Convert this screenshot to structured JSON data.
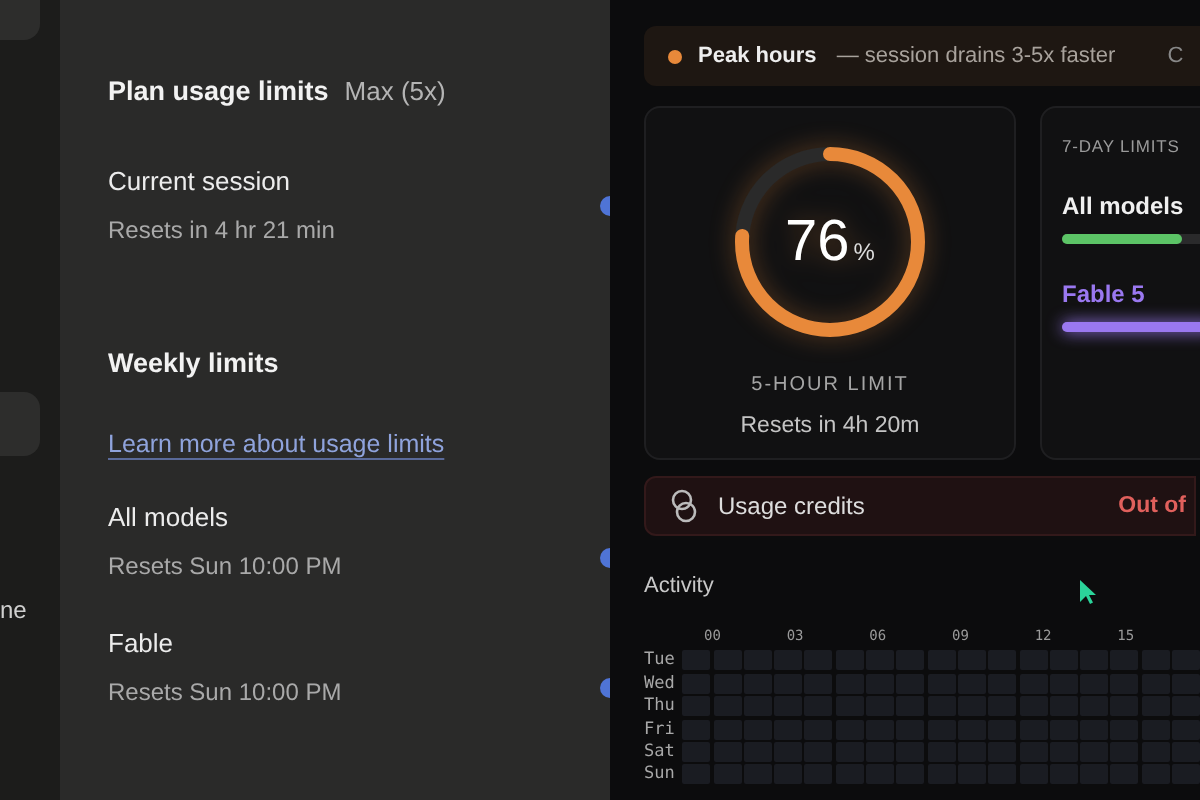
{
  "sidebar_fragment": "ne",
  "plan": {
    "title": "Plan usage limits",
    "tier": "Max (5x)"
  },
  "session": {
    "name": "Current session",
    "reset": "Resets in 4 hr 21 min"
  },
  "weekly": {
    "title": "Weekly limits",
    "link": "Learn more about usage limits",
    "items": [
      {
        "name": "All models",
        "reset": "Resets Sun 10:00 PM"
      },
      {
        "name": "Fable",
        "reset": "Resets Sun 10:00 PM"
      }
    ]
  },
  "peak": {
    "label": "Peak hours",
    "detail": "— session drains 3-5x faster",
    "trailing": "C"
  },
  "five_hour": {
    "value": "76",
    "unit": "%",
    "level": 0.76,
    "label": "5-HOUR LIMIT",
    "reset": "Resets in 4h 20m"
  },
  "seven_day": {
    "title": "7-DAY LIMITS",
    "models": [
      {
        "name": "All models",
        "level": 0.43,
        "color": "#5cc466",
        "highlighted": false
      },
      {
        "name": "Fable 5",
        "level": 0.56,
        "color": "#9a78f0",
        "highlighted": true
      }
    ]
  },
  "credits": {
    "label": "Usage credits",
    "status": "Out of"
  },
  "activity": {
    "title": "Activity",
    "hours": [
      "00",
      "03",
      "06",
      "09",
      "12",
      "15"
    ],
    "days": [
      "Tue",
      "Wed",
      "Thu",
      "Fri",
      "Sat",
      "Sun"
    ]
  }
}
